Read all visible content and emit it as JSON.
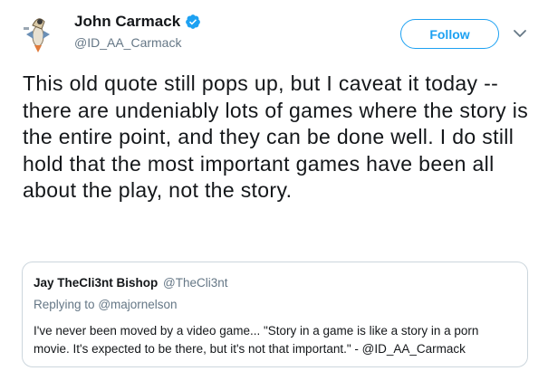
{
  "header": {
    "fullname": "John Carmack",
    "screenname": "@ID_AA_Carmack",
    "follow_label": "Follow",
    "verified_icon": "verified-badge-icon",
    "avatar_icon": "rocket-avatar-icon"
  },
  "tweet": {
    "text": "This old quote still pops up, but I caveat it today -- there are undeniably lots of games where the story is the entire point, and they can be done well.  I do still hold that the most important games have been all about the play, not the story."
  },
  "quote": {
    "name": "Jay TheCli3nt Bishop",
    "handle": "@TheCli3nt",
    "replying_prefix": "Replying to",
    "replying_to": "@majornelson",
    "text": "I've never been moved by a video game... \"Story in a game is like a story in a porn movie. It's expected to be there, but it's not that important.\" - @ID_AA_Carmack"
  },
  "colors": {
    "accent": "#1da1f2",
    "text": "#14171a",
    "secondary": "#657786",
    "border": "#ccd6dd"
  }
}
